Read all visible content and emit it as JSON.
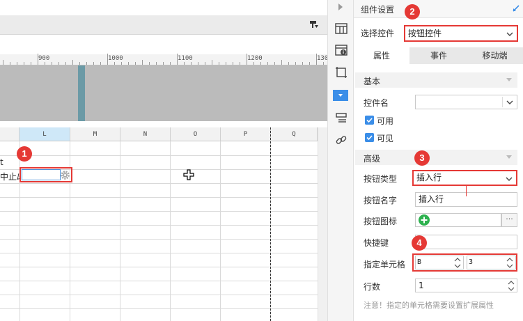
{
  "ruler": {
    "labels": [
      "900",
      "1000",
      "1100",
      "1200",
      "130"
    ]
  },
  "sheet": {
    "columns": [
      "L",
      "M",
      "N",
      "O",
      "P",
      "Q"
    ],
    "cells": [
      {
        "text": "t"
      },
      {
        "text": "中止ﾑ"
      }
    ]
  },
  "badges": [
    "1",
    "2",
    "3",
    "4"
  ],
  "panel": {
    "title": "组件设置",
    "select_control_label": "选择控件",
    "select_control_value": "按钮控件",
    "tabs": [
      "属性",
      "事件",
      "移动端"
    ],
    "basic_section": "基本",
    "control_name_label": "控件名",
    "control_name_value": "",
    "enabled_label": "可用",
    "visible_label": "可见",
    "advanced_section": "高级",
    "button_type_label": "按钮类型",
    "button_type_value": "插入行",
    "button_name_label": "按钮名字",
    "button_name_value": "插入行",
    "button_icon_label": "按钮图标",
    "more_label": "···",
    "shortcut_label": "快捷键",
    "shortcut_value": "",
    "target_cell_label": "指定单元格",
    "target_cell_col": "B",
    "target_cell_row": "3",
    "row_count_label": "行数",
    "row_count_value": "1",
    "note": "注意！指定的单元格需要设置扩展属性"
  },
  "colors": {
    "accent": "#3b8ee8",
    "highlight": "#e53935",
    "icon_green": "#2db14e"
  }
}
